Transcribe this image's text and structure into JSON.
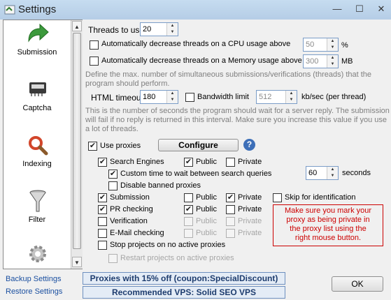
{
  "window": {
    "title": "Settings",
    "minimize": "—",
    "maximize": "☐",
    "close": "✕"
  },
  "sidebar": {
    "items": [
      {
        "label": "Submission",
        "icon": "green-arrow-icon"
      },
      {
        "label": "Captcha",
        "icon": "captcha-chip-icon"
      },
      {
        "label": "Indexing",
        "icon": "magnifier-icon"
      },
      {
        "label": "Filter",
        "icon": "funnel-icon"
      },
      {
        "label": "",
        "icon": "gear-icon"
      }
    ]
  },
  "links": {
    "backup": "Backup Settings",
    "restore": "Restore Settings"
  },
  "threads": {
    "label": "Threads to use",
    "value": "20"
  },
  "cpu": {
    "label": "Automatically decrease threads on a CPU usage above",
    "value": "50",
    "unit": "%"
  },
  "memory": {
    "label": "Automatically decrease threads on a Memory usage above",
    "value": "300",
    "unit": "MB"
  },
  "threads_help": [
    "Define the max. number of simultaneous submissions/verifications (threads) that the",
    "program should perform."
  ],
  "html_timeout": {
    "label": "HTML timeout",
    "value": "180"
  },
  "bandwidth": {
    "label": "Bandwidth limit",
    "value": "512",
    "unit": "kb/sec (per thread)"
  },
  "timeout_help": [
    "This is the number of seconds the program should wait for a server reply. The submission",
    "will fail if no reply is returned in this interval. Make sure you increase this value if you use",
    "a lot of threads."
  ],
  "use_proxies": {
    "label": "Use proxies",
    "checked": true
  },
  "configure_btn": "Configure",
  "help_icon": "?",
  "proxy": {
    "search_engines": {
      "label": "Search Engines",
      "public": "Public",
      "private": "Private"
    },
    "custom_wait": {
      "label": "Custom time to wait between search queries",
      "value": "60",
      "unit": "seconds"
    },
    "disable_banned": "Disable banned proxies",
    "submission": {
      "label": "Submission",
      "public": "Public",
      "private": "Private",
      "skip": "Skip for identification"
    },
    "pr_checking": {
      "label": "PR checking",
      "public": "Public",
      "private": "Private"
    },
    "verification": {
      "label": "Verification",
      "public": "Public",
      "private": "Private"
    },
    "email_checking": {
      "label": "E-Mail checking",
      "public": "Public",
      "private": "Private"
    },
    "stop_projects": "Stop projects on no active proxies",
    "restart_projects": "Restart projects on active proxies"
  },
  "warning_note": [
    "Make sure you mark your",
    "proxy as being private in",
    "the proxy list using the",
    "right mouse button."
  ],
  "promos": [
    "Proxies with 15% off  (coupon:SpecialDiscount)",
    "Recommended VPS: Solid SEO VPS"
  ],
  "ok_btn": "OK",
  "check_mark": "✔"
}
